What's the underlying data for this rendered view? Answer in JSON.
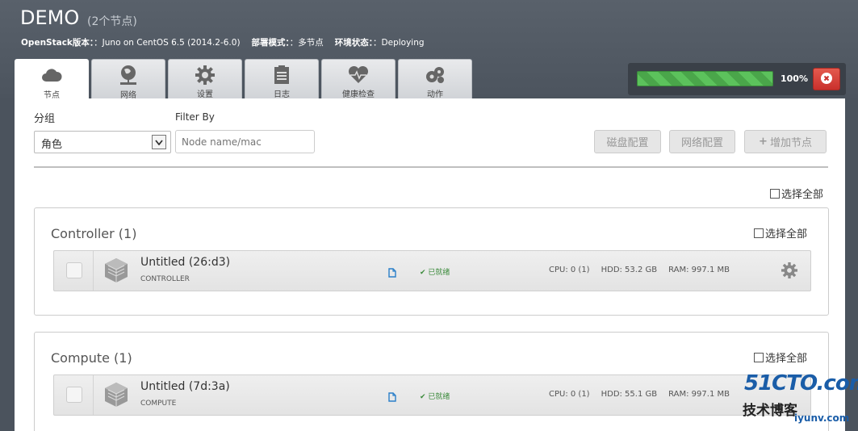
{
  "header": {
    "title": "DEMO",
    "subtitle": "(2个节点)",
    "meta": [
      {
        "key": "OpenStack版本：",
        "value": "：Juno on CentOS 6.5 (2014.2-6.0)"
      },
      {
        "key": "部署模式：",
        "value": "：多节点"
      },
      {
        "key": "环境状态：",
        "value": "：Deploying"
      }
    ]
  },
  "tabs": [
    {
      "label": "节点",
      "icon": "cloud-icon",
      "active": true
    },
    {
      "label": "网络",
      "icon": "network-icon",
      "active": false
    },
    {
      "label": "设置",
      "icon": "gear-icon",
      "active": false
    },
    {
      "label": "日志",
      "icon": "log-icon",
      "active": false
    },
    {
      "label": "健康检查",
      "icon": "heart-icon",
      "active": false
    },
    {
      "label": "动作",
      "icon": "actions-icon",
      "active": false
    }
  ],
  "progress": {
    "value": 100,
    "label": "100%"
  },
  "toolbar": {
    "group_label": "分组",
    "group_select": "角色",
    "filter_label": "Filter By",
    "filter_placeholder": "Node name/mac",
    "disk_button": "磁盘配置",
    "network_button": "网络配置",
    "add_node_button": "增加节点",
    "select_all": "选择全部"
  },
  "groups": [
    {
      "title": "Controller (1)",
      "select_all": "选择全部",
      "node": {
        "name": "Untitled (26:d3)",
        "role": "CONTROLLER",
        "status": "已就绪",
        "cpu": "CPU: 0 (1)",
        "hdd": "HDD: 53.2 GB",
        "ram": "RAM: 997.1 MB"
      }
    },
    {
      "title": "Compute (1)",
      "select_all": "选择全部",
      "node": {
        "name": "Untitled (7d:3a)",
        "role": "COMPUTE",
        "status": "已就绪",
        "cpu": "CPU: 0 (1)",
        "hdd": "HDD: 55.1 GB",
        "ram": "RAM: 997.1 MB"
      }
    }
  ],
  "watermark": {
    "line1": "51CTO.com",
    "line2": "技术博客",
    "line3": "iyunv.com"
  },
  "colors": {
    "accent_green": "#4aa64a",
    "danger": "#c9302c",
    "status_green": "#3c8b3c",
    "header_bg": "#4b535d"
  }
}
